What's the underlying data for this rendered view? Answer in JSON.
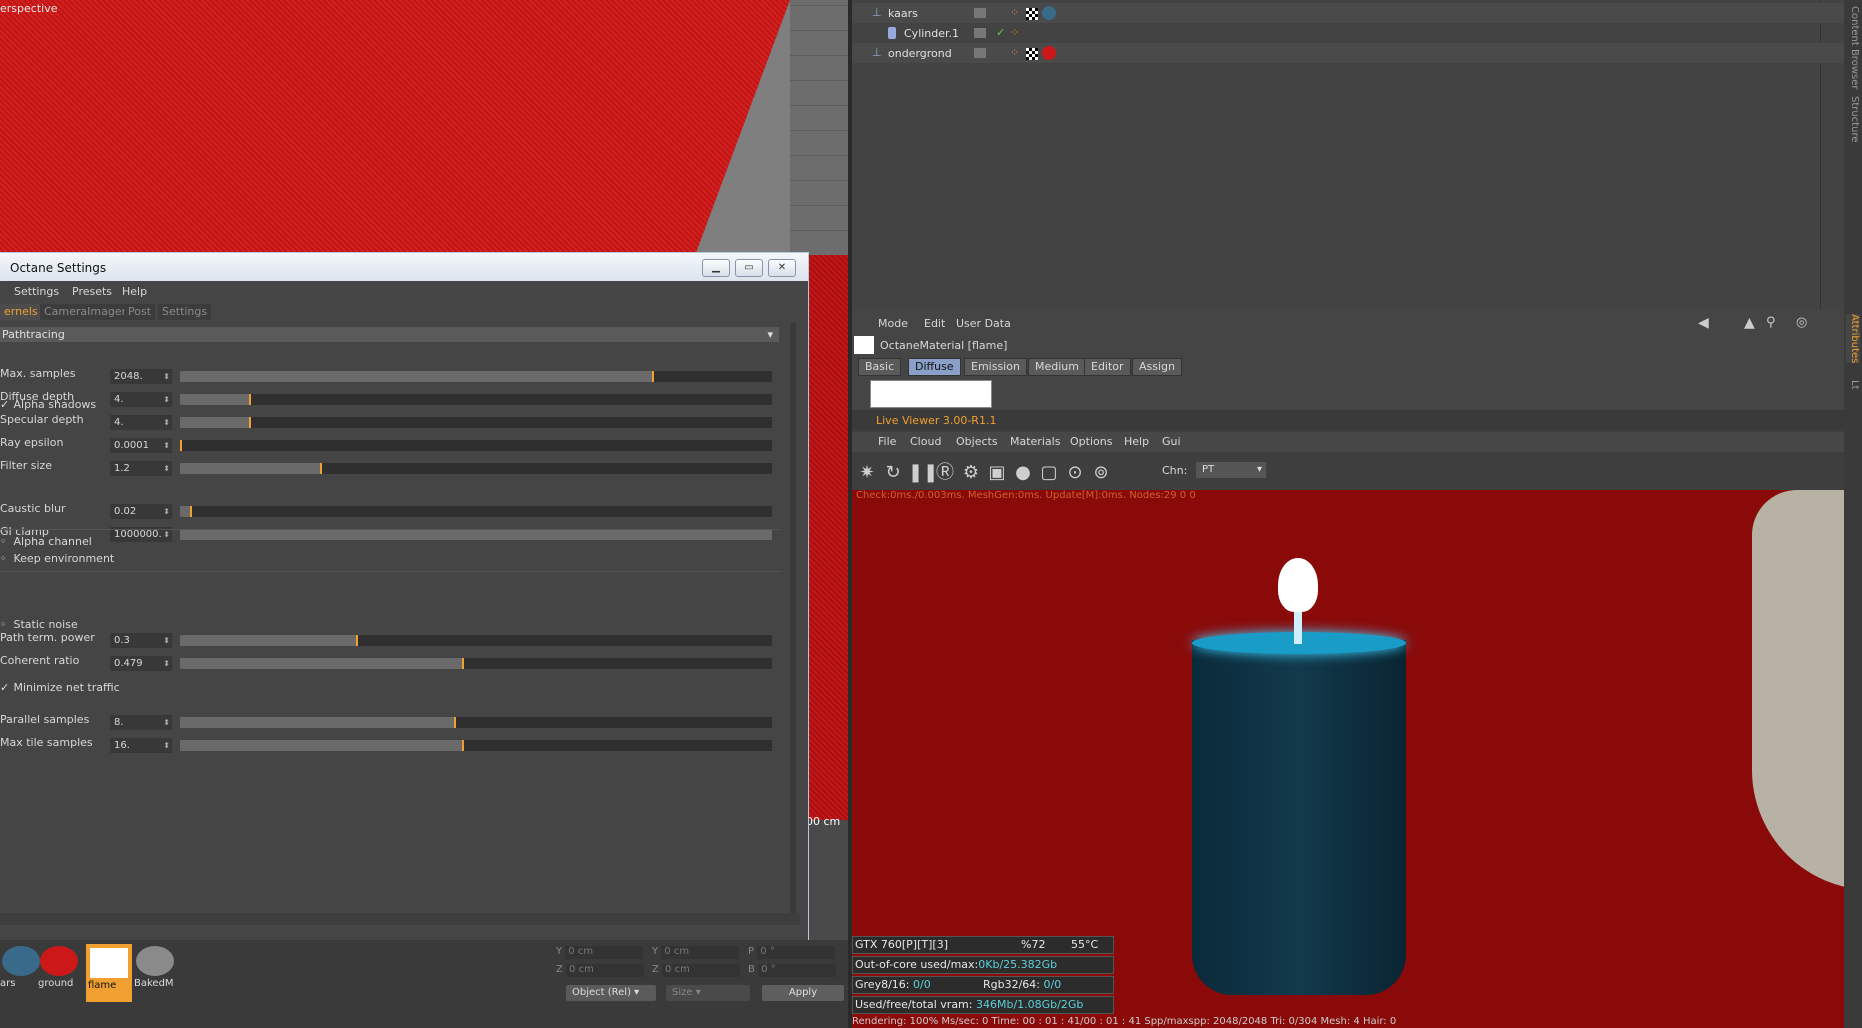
{
  "viewport": {
    "label": "erspective",
    "dimension_label": "00 cm"
  },
  "octane_settings": {
    "title": "Octane Settings",
    "menu": [
      "Settings",
      "Presets",
      "Help"
    ],
    "tabs": [
      "ernels",
      "CameraImager",
      "Post",
      "Settings"
    ],
    "kernel": "Pathtracing",
    "params": [
      {
        "label": "Max. samples",
        "value": "2048.",
        "fill": 0.8
      },
      {
        "label": "Diffuse depth",
        "value": "4.",
        "fill": 0.12
      },
      {
        "label": "Specular depth",
        "value": "4.",
        "fill": 0.12
      },
      {
        "label": "Ray epsilon",
        "value": "0.0001",
        "fill": 0.0
      },
      {
        "label": "Filter size",
        "value": "1.2",
        "fill": 0.24
      },
      {
        "label": "Caustic blur",
        "value": "0.02",
        "fill": 0.02
      },
      {
        "label": "GI clamp",
        "value": "1000000.",
        "fill": 1.0
      },
      {
        "label": "Path term. power",
        "value": "0.3",
        "fill": 0.3
      },
      {
        "label": "Coherent ratio",
        "value": "0.479",
        "fill": 0.479
      },
      {
        "label": "Parallel samples",
        "value": "8.",
        "fill": 0.467
      },
      {
        "label": "Max tile samples",
        "value": "16.",
        "fill": 0.48
      }
    ],
    "checks": {
      "alpha_shadows": "Alpha shadows",
      "alpha_channel": "Alpha channel",
      "keep_environment": "Keep environment",
      "static_noise": "Static noise",
      "minimize_net_traffic": "Minimize net traffic"
    },
    "check_mark": "✓"
  },
  "materials": [
    {
      "name": "ars",
      "color": "#3a6a8a"
    },
    {
      "name": "ground",
      "color": "#cc1818"
    },
    {
      "name": "flame",
      "color": "#ffffff"
    },
    {
      "name": "BakedM",
      "color": "#8a8a8a"
    }
  ],
  "coords": {
    "y1": "Y",
    "y1_val": "0 cm",
    "y2": "Y",
    "y2_val": "0 cm",
    "p": "P",
    "p_val": "0 °",
    "z1": "Z",
    "z1_val": "0 cm",
    "z2": "Z",
    "z2_val": "0 cm",
    "b": "B",
    "b_val": "0 °",
    "object_rel": "Object (Rel)",
    "size": "Size",
    "apply": "Apply"
  },
  "object_manager": {
    "rows": [
      {
        "name": "kaars",
        "icon": "null-object-icon"
      },
      {
        "name": "Cylinder.1",
        "icon": "cylinder-icon"
      },
      {
        "name": "ondergrond",
        "icon": "null-object-icon"
      }
    ]
  },
  "right_tabs": [
    "Content Browser",
    "Structure",
    "Attributes",
    "Lt"
  ],
  "attributes": {
    "menu": [
      "Mode",
      "Edit",
      "User Data"
    ],
    "title": "OctaneMaterial [flame]",
    "tabs": [
      "Basic",
      "Diffuse",
      "Emission",
      "Medium",
      "Editor",
      "Assign"
    ],
    "active_tab": "Diffuse"
  },
  "live_viewer": {
    "title": "Live Viewer 3.00-R1.1",
    "menu": [
      "File",
      "Cloud",
      "Objects",
      "Materials",
      "Options",
      "Help",
      "Gui"
    ],
    "chn_label": "Chn:",
    "chn_value": "PT",
    "status_line": "Check:0ms./0.003ms. MeshGen:0ms. Update[M]:0ms. Nodes:29  0 0"
  },
  "gpu_info": {
    "gpu": "GTX 760[P][T][3]",
    "usage": "%72",
    "temp": "55°C",
    "out_of_core_label": "Out-of-core used/max:",
    "out_of_core_val": "0Kb/25.382Gb",
    "grey_label": "Grey8/16:",
    "grey_val": "0/0",
    "rgb_label": "Rgb32/64:",
    "rgb_val": "0/0",
    "vram_label": "Used/free/total vram:",
    "vram_val": "346Mb/1.08Gb/2Gb"
  },
  "render_status": "Rendering: 100%      Ms/sec: 0      Time: 00 : 01 : 41/00 : 01 : 41      Spp/maxspp: 2048/2048      Tri: 0/304      Mesh: 4      Hair: 0"
}
